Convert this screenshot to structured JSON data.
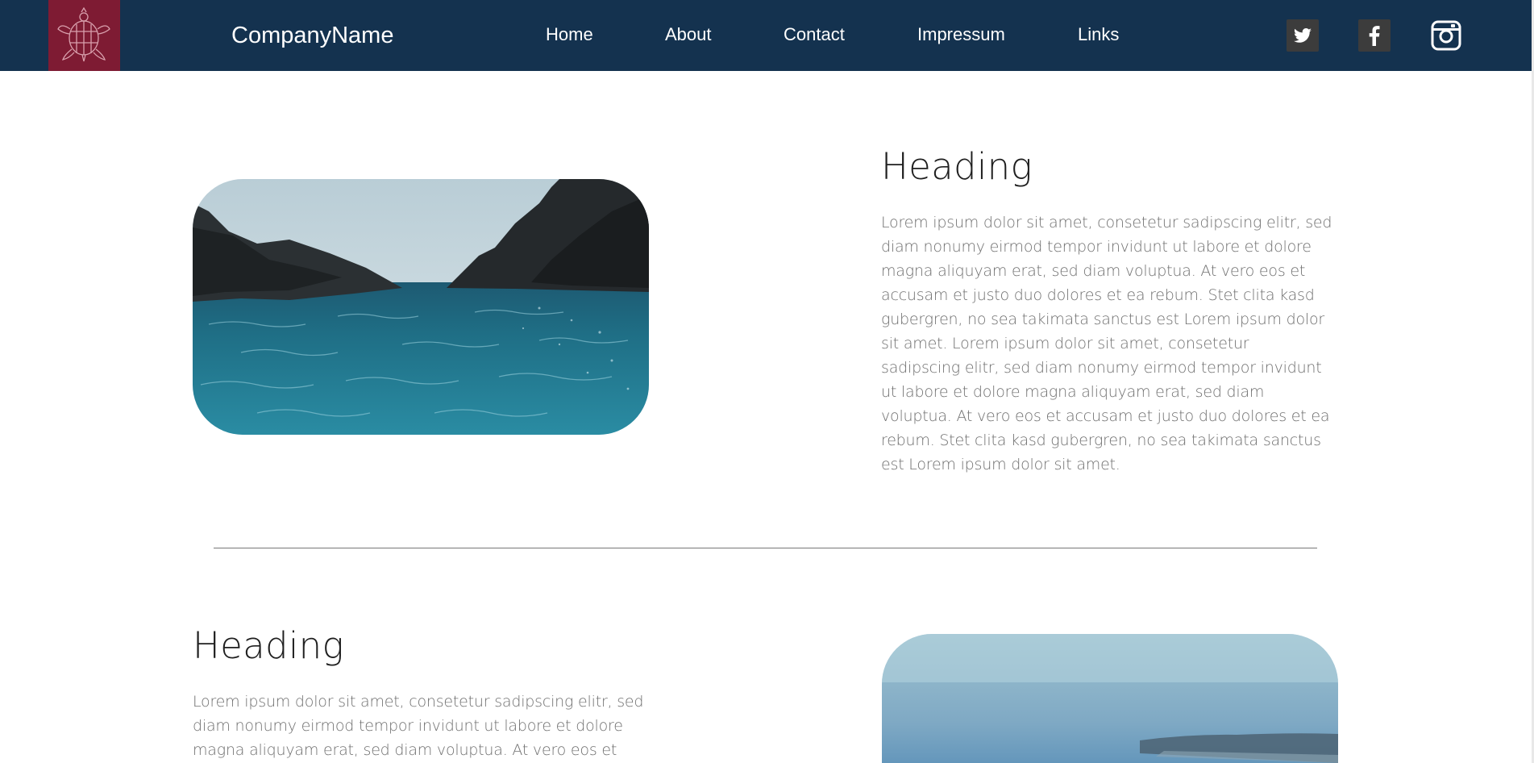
{
  "brand": {
    "name": "CompanyName",
    "logo_icon": "turtle-icon",
    "logo_bg": "#7e1b33"
  },
  "nav": {
    "bg": "#14324f",
    "items": [
      {
        "label": "Home"
      },
      {
        "label": "About"
      },
      {
        "label": "Contact"
      },
      {
        "label": "Impressum"
      },
      {
        "label": "Links"
      }
    ]
  },
  "social": [
    {
      "icon": "twitter-icon"
    },
    {
      "icon": "facebook-icon"
    },
    {
      "icon": "instagram-icon"
    }
  ],
  "sections": [
    {
      "heading": "Heading",
      "text": "Lorem ipsum dolor sit amet, consetetur sadipscing elitr, sed diam nonumy eirmod tempor invidunt ut labore et dolore magna aliquyam erat, sed diam voluptua. At vero eos et accusam et justo duo dolores et ea rebum. Stet clita kasd gubergren, no sea takimata sanctus est Lorem ipsum dolor sit amet. Lorem ipsum dolor sit amet, consetetur sadipscing elitr, sed diam nonumy eirmod tempor invidunt ut labore et dolore magna aliquyam erat, sed diam voluptua. At vero eos et accusam et justo duo dolores et ea rebum. Stet clita kasd gubergren, no sea takimata sanctus est Lorem ipsum dolor sit amet.",
      "image": "sea-cliffs-photo"
    },
    {
      "heading": "Heading",
      "text": "Lorem ipsum dolor sit amet, consetetur sadipscing elitr, sed diam nonumy eirmod tempor invidunt ut labore et dolore magna aliquyam erat, sed diam voluptua. At vero eos et",
      "image": "coastline-photo"
    }
  ]
}
